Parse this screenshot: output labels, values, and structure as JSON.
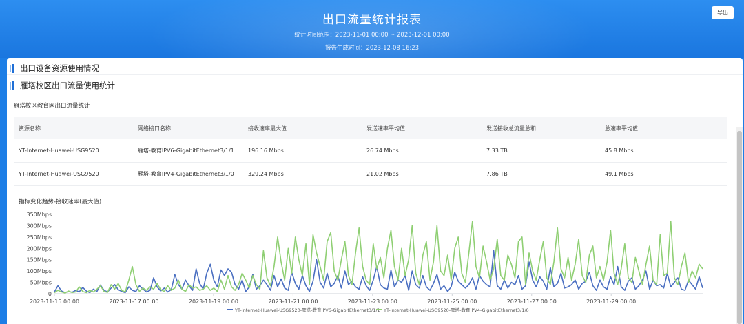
{
  "header": {
    "title": "出口流量统计报表",
    "time_range": "统计时间范围：2023-11-01 00:00 ~ 2023-12-01 00:00",
    "generated": "报告生成时间：2023-12-08 16:23",
    "export_label": "导出"
  },
  "sections": {
    "device_usage": "出口设备资源使用情况",
    "campus_stats": "雁塔校区出口流量使用统计"
  },
  "table": {
    "caption": "雁塔校区教育网出口流量统计",
    "headers": [
      "资源名称",
      "网络接口名称",
      "接收速率最大值",
      "发送速率平均值",
      "发送接收总流量总和",
      "总速率平均值"
    ],
    "rows": [
      [
        "YT-Internet-Huawei-USG9520",
        "雁塔-教育IPV6-GigabitEthernet3/1/1",
        "196.16 Mbps",
        "26.74 Mbps",
        "7.33 TB",
        "45.8 Mbps"
      ],
      [
        "YT-Internet-Huawei-USG9520",
        "雁塔-教育IPV4-GigabitEthernet3/1/0",
        "329.24 Mbps",
        "21.02 Mbps",
        "7.86 TB",
        "49.1 Mbps"
      ]
    ]
  },
  "chart_title": "指标变化趋势-接收速率(最大值)",
  "chart_data": {
    "type": "line",
    "title": "指标变化趋势-接收速率(最大值)",
    "ylim": [
      0,
      350
    ],
    "y_ticks": [
      "0",
      "50Mbps",
      "100Mbps",
      "150Mbps",
      "200Mbps",
      "250Mbps",
      "300Mbps",
      "350Mbps"
    ],
    "x_ticks": [
      "2023-11-15 00:00",
      "2023-11-17 00:00",
      "2023-11-19 00:00",
      "2023-11-21 00:00",
      "2023-11-23 00:00",
      "2023-11-25 00:00",
      "2023-11-27 00:00",
      "2023-11-29 00:00"
    ],
    "x_tick_positions": [
      0,
      2,
      4,
      6,
      8,
      10,
      12,
      14
    ],
    "x_range": [
      0,
      16.3
    ],
    "grid": "none",
    "legend": "bottom",
    "series": [
      {
        "name": "YT-Internet-Huawei-USG9520-雁塔-教育IPV6-GigabitEthernet3/1/1",
        "color": "#4a6fc1",
        "values": [
          8,
          35,
          12,
          5,
          10,
          6,
          15,
          8,
          28,
          12,
          5,
          20,
          10,
          38,
          15,
          8,
          25,
          40,
          18,
          10,
          5,
          30,
          15,
          10,
          35,
          20,
          8,
          15,
          70,
          30,
          12,
          25,
          8,
          18,
          85,
          40,
          20,
          60,
          35,
          15,
          110,
          45,
          20,
          90,
          130,
          60,
          30,
          105,
          80,
          110,
          95,
          40,
          20,
          60,
          10,
          30,
          85,
          20,
          35,
          60,
          40,
          15,
          80,
          30,
          65,
          25,
          15,
          95,
          45,
          20,
          80,
          35,
          10,
          55,
          150,
          50,
          25,
          90,
          30,
          45,
          80,
          25,
          100,
          40,
          55,
          30,
          20,
          75,
          35,
          15,
          60,
          120,
          40,
          25,
          20,
          105,
          30,
          60,
          50,
          80,
          15,
          100,
          40,
          25,
          80,
          30,
          15,
          45,
          85,
          20,
          35,
          10,
          30,
          95,
          55,
          40,
          25,
          40,
          70,
          20,
          80,
          55,
          40,
          30,
          190,
          35,
          20,
          60,
          25,
          50,
          40,
          80,
          20,
          35,
          140,
          60,
          30,
          75,
          55,
          20,
          115,
          30,
          45,
          90,
          25,
          30,
          40,
          60,
          20,
          45,
          55,
          95,
          35,
          15,
          60,
          30,
          20,
          75,
          40,
          120,
          30,
          15,
          55,
          70,
          20,
          35,
          60,
          100,
          20,
          60,
          35,
          40,
          25,
          90,
          30,
          50,
          70,
          20,
          15,
          60,
          40,
          20,
          75,
          25
        ]
      },
      {
        "name": "YT-Internet-Huawei-USG9520-雁塔-教育IPV4-GigabitEthernet3/1/0",
        "color": "#8fcf73",
        "values": [
          5,
          15,
          8,
          3,
          12,
          5,
          8,
          30,
          10,
          5,
          15,
          8,
          20,
          35,
          10,
          6,
          40,
          20,
          45,
          15,
          8,
          60,
          120,
          40,
          10,
          25,
          15,
          30,
          20,
          45,
          18,
          10,
          35,
          15,
          25,
          60,
          20,
          10,
          40,
          25,
          30,
          15,
          20,
          35,
          15,
          25,
          10,
          60,
          20,
          80,
          30,
          15,
          40,
          90,
          60,
          25,
          80,
          40,
          20,
          190,
          70,
          35,
          120,
          250,
          140,
          60,
          200,
          90,
          250,
          150,
          80,
          220,
          40,
          260,
          180,
          120,
          60,
          230,
          270,
          100,
          60,
          150,
          230,
          80,
          40,
          180,
          290,
          120,
          60,
          40,
          220,
          110,
          160,
          70,
          200,
          280,
          120,
          60,
          200,
          80,
          150,
          300,
          90,
          40,
          170,
          230,
          60,
          140,
          300,
          100,
          80,
          170,
          60,
          200,
          250,
          90,
          50,
          180,
          320,
          120,
          70,
          210,
          140,
          60,
          110,
          240,
          80,
          60,
          170,
          130,
          70,
          230,
          250,
          40,
          180,
          100,
          60,
          150,
          230,
          70,
          40,
          140,
          290,
          110,
          70,
          160,
          60,
          130,
          240,
          80,
          50,
          170,
          210,
          70,
          120,
          60,
          140,
          280,
          90,
          40,
          110,
          220,
          70,
          50,
          160,
          100,
          40,
          130,
          210,
          60,
          40,
          260,
          80,
          90,
          320,
          70,
          40,
          120,
          180,
          50,
          100,
          70,
          130,
          110
        ]
      }
    ]
  }
}
